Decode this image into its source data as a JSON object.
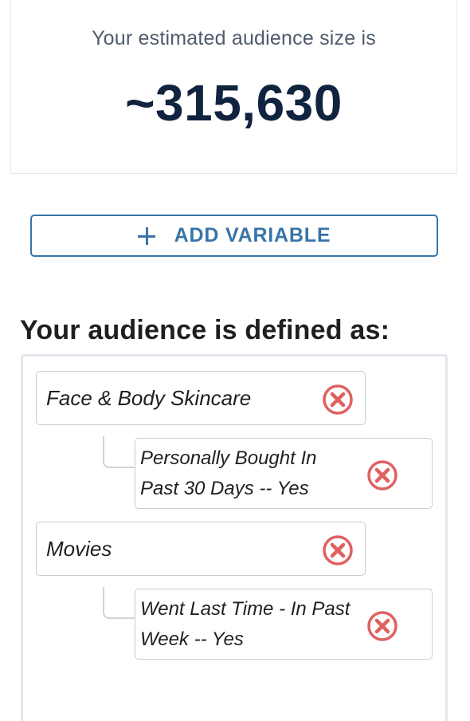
{
  "summary": {
    "label": "Your estimated audience size is",
    "value": "~315,630"
  },
  "add_variable": {
    "label": "ADD VARIABLE",
    "icon": "plus-icon"
  },
  "audience": {
    "heading": "Your audience is defined as:",
    "variables": [
      {
        "name": "Face & Body Skincare",
        "condition_line1": "Personally Bought In",
        "condition_line2": "Past 30 Days -- Yes"
      },
      {
        "name": "Movies",
        "condition_line1": "Went Last Time - In Past",
        "condition_line2": "Week -- Yes"
      }
    ]
  },
  "colors": {
    "accent": "#3874a8",
    "remove": "#e06060",
    "value_text": "#10233f"
  }
}
